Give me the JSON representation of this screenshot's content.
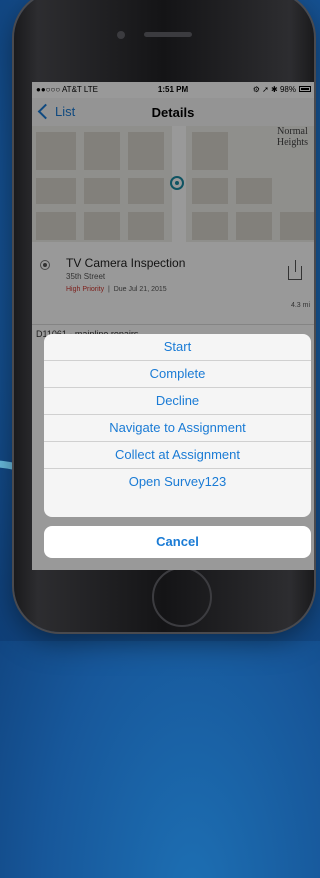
{
  "status": {
    "carrier": "●●○○○ AT&T  LTE",
    "time": "1:51 PM",
    "right": "⚙ ➚ ✱ 98%"
  },
  "nav": {
    "back_label": "List",
    "title": "Details"
  },
  "map": {
    "area_label_line1": "Normal",
    "area_label_line2": "Heights"
  },
  "assignment": {
    "title": "TV Camera Inspection",
    "street": "35th Street",
    "priority": "High Priority",
    "due": "Due Jul 21, 2015",
    "distance": "4.3 mi",
    "description": "D11061 - mainline repairs"
  },
  "actions": [
    "Start",
    "Complete",
    "Decline",
    "Navigate to Assignment",
    "Collect at Assignment",
    "Open Survey123"
  ],
  "cancel_label": "Cancel",
  "colors": {
    "accent": "#1a7bd5",
    "priority": "#d0362f",
    "background": "#17579a"
  }
}
